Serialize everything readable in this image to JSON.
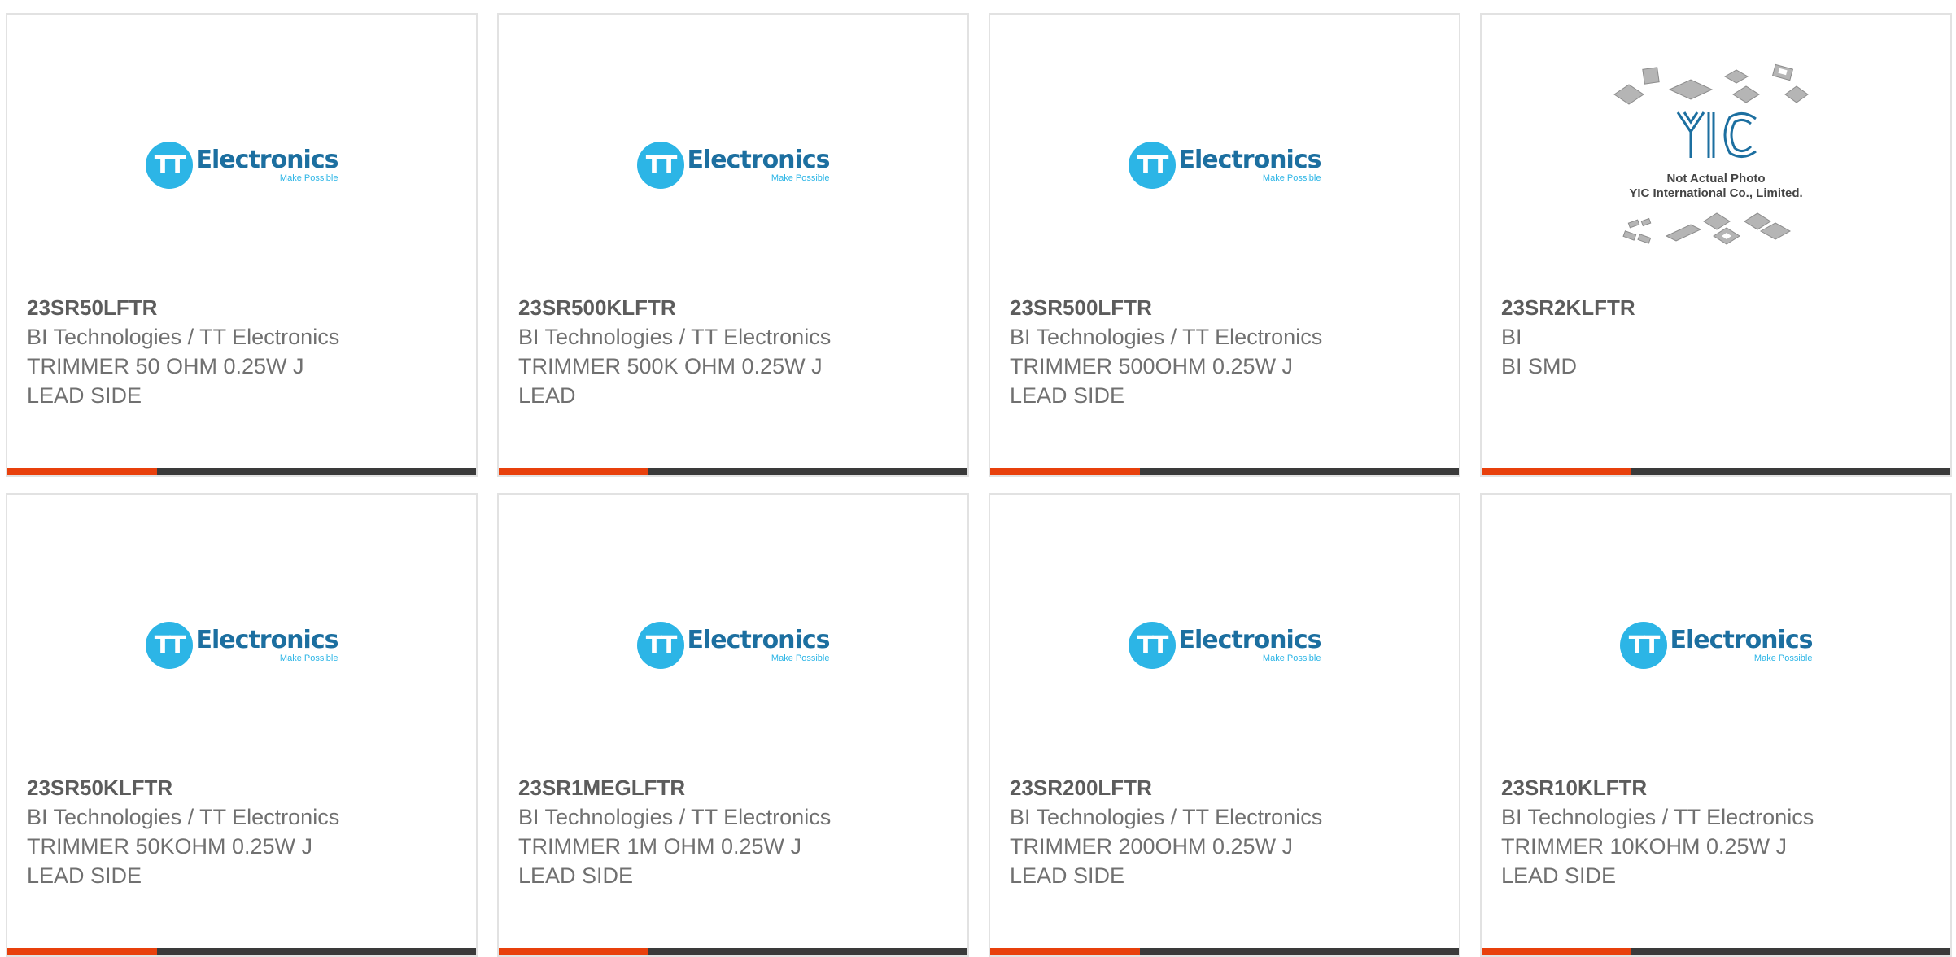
{
  "logos": {
    "tt": {
      "badge": "TT",
      "word": "Electronics",
      "tagline": "Make Possible",
      "brand_color": "#2cb5e6",
      "text_color": "#1c6fa0"
    },
    "yic": {
      "mark": "YIC",
      "line1": "Not Actual Photo",
      "line2": "YIC International Co., Limited."
    }
  },
  "colors": {
    "accent": "#e8400c",
    "bar": "#3a3a3a",
    "card_border": "#e2e2e2"
  },
  "products": [
    {
      "part_number": "23SR50LFTR",
      "manufacturer": "BI Technologies / TT Electronics",
      "desc_line1": "TRIMMER 50 OHM 0.25W J",
      "desc_line2": "LEAD SIDE",
      "image": "tt-electronics-logo"
    },
    {
      "part_number": "23SR500KLFTR",
      "manufacturer": "BI Technologies / TT Electronics",
      "desc_line1": "TRIMMER 500K OHM 0.25W J",
      "desc_line2": "LEAD",
      "image": "tt-electronics-logo"
    },
    {
      "part_number": "23SR500LFTR",
      "manufacturer": "BI Technologies / TT Electronics",
      "desc_line1": "TRIMMER 500OHM 0.25W J",
      "desc_line2": "LEAD SIDE",
      "image": "tt-electronics-logo"
    },
    {
      "part_number": "23SR2KLFTR",
      "manufacturer": "BI",
      "desc_line1": "BI SMD",
      "desc_line2": "",
      "image": "yic-not-actual-photo"
    },
    {
      "part_number": "23SR50KLFTR",
      "manufacturer": "BI Technologies / TT Electronics",
      "desc_line1": "TRIMMER 50KOHM 0.25W J",
      "desc_line2": "LEAD SIDE",
      "image": "tt-electronics-logo"
    },
    {
      "part_number": "23SR1MEGLFTR",
      "manufacturer": "BI Technologies / TT Electronics",
      "desc_line1": "TRIMMER 1M OHM 0.25W J",
      "desc_line2": "LEAD SIDE",
      "image": "tt-electronics-logo"
    },
    {
      "part_number": "23SR200LFTR",
      "manufacturer": "BI Technologies / TT Electronics",
      "desc_line1": "TRIMMER 200OHM 0.25W J",
      "desc_line2": "LEAD SIDE",
      "image": "tt-electronics-logo"
    },
    {
      "part_number": "23SR10KLFTR",
      "manufacturer": "BI Technologies / TT Electronics",
      "desc_line1": "TRIMMER 10KOHM 0.25W J",
      "desc_line2": "LEAD SIDE",
      "image": "tt-electronics-logo"
    }
  ]
}
